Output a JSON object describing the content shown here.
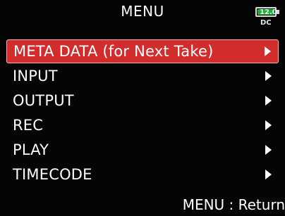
{
  "header": {
    "title": "MENU",
    "battery": {
      "voltage": "12.0",
      "source": "DC",
      "level": 1.0,
      "color": "#16b234"
    }
  },
  "menu": {
    "items": [
      {
        "label": "META DATA (for Next Take)",
        "selected": true,
        "icon": "chevron-right-icon"
      },
      {
        "label": "INPUT",
        "selected": false,
        "icon": "chevron-right-icon"
      },
      {
        "label": "OUTPUT",
        "selected": false,
        "icon": "chevron-right-icon"
      },
      {
        "label": "REC",
        "selected": false,
        "icon": "chevron-right-icon"
      },
      {
        "label": "PLAY",
        "selected": false,
        "icon": "chevron-right-icon"
      },
      {
        "label": "TIMECODE",
        "selected": false,
        "icon": "chevron-right-icon"
      }
    ]
  },
  "footer": {
    "hint": "MENU : Return"
  },
  "colors": {
    "selection": "#d22d2d",
    "background": "#050505",
    "text": "#ffffff"
  }
}
